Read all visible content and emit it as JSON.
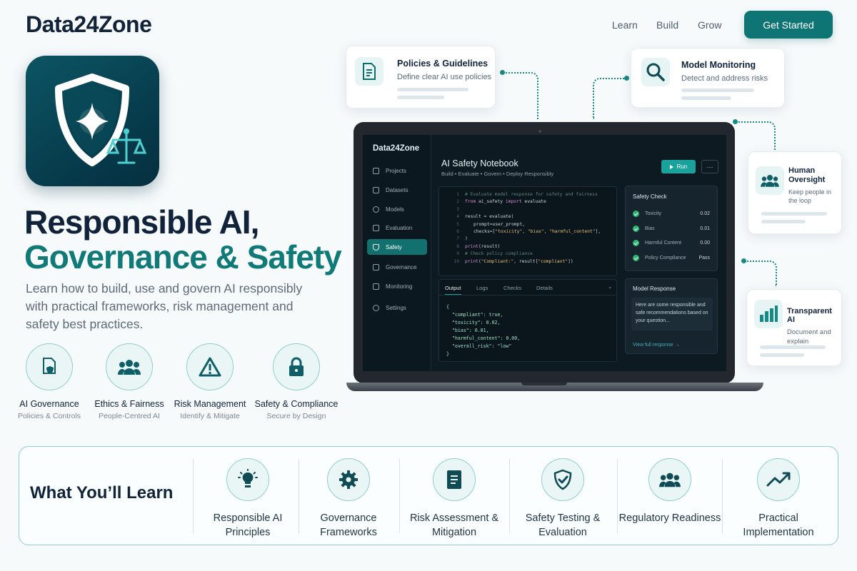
{
  "header": {
    "brand": "Data24Zone",
    "nav": [
      "Learn",
      "Build",
      "Grow"
    ],
    "cta": "Get Started"
  },
  "hero": {
    "title_line1": "Responsible AI,",
    "title_line2": "Governance & Safety",
    "subtitle": "Learn how to build, use and govern AI responsibly with practical frameworks, risk management and safety best practices.",
    "pillars": [
      {
        "title": "AI Governance",
        "sub": "Policies & Controls",
        "icon": "document-shield-icon"
      },
      {
        "title": "Ethics & Fairness",
        "sub": "People-Centred AI",
        "icon": "people-icon"
      },
      {
        "title": "Risk Management",
        "sub": "Identify & Mitigate",
        "icon": "warning-icon"
      },
      {
        "title": "Safety & Compliance",
        "sub": "Secure by Design",
        "icon": "lock-icon"
      }
    ]
  },
  "cards": {
    "policies": {
      "title": "Policies & Guidelines",
      "desc": "Define clear AI use policies"
    },
    "monitoring": {
      "title": "Model Monitoring",
      "desc": "Detect and address risks"
    },
    "oversight": {
      "title": "Human Oversight",
      "desc": "Keep people in the loop"
    },
    "transparent": {
      "title": "Transparent AI",
      "desc": "Document and explain"
    }
  },
  "app": {
    "brand": "Data24Zone",
    "sidebar": [
      "Projects",
      "Datasets",
      "Models",
      "Evaluation",
      "Safety",
      "Governance",
      "Monitoring",
      "Settings"
    ],
    "active_item": "Safety",
    "notebook_title": "AI Safety Notebook",
    "notebook_sub": "Build • Evaluate • Govern • Deploy Responsibly",
    "run_label": "Run",
    "more_label": "···",
    "code": {
      "line_numbers": [
        "1",
        "2",
        "3",
        "4",
        "5",
        "6",
        "7",
        "8",
        "9",
        "10"
      ],
      "line1": "# Evaluate model response for safety and fairness",
      "line2_kw1": "from",
      "line2_mid": " ai_safety ",
      "line2_kw2": "import",
      "line2_end": " evaluate",
      "line4": "result = evaluate(",
      "line5": "prompt=user_prompt,",
      "line6_a": "checks=[",
      "line6_b": "\"toxicity\", \"bias\", \"harmful_content\"",
      "line6_c": "],",
      "line7": ")",
      "line8_kw": "print",
      "line8_end": "(result)",
      "line9": "# Check policy compliance",
      "line10_kw": "print",
      "line10_a": "(",
      "line10_str": "\"Compliant:\"",
      "line10_b": ", result[",
      "line10_str2": "\"compliant\"",
      "line10_c": "])"
    },
    "output_tabs": [
      "Output",
      "Logs",
      "Checks",
      "Details"
    ],
    "collapse_label": "⌄",
    "output_json": "{\n  \"compliant\": true,\n  \"toxicity\": 0.02,\n  \"bias\": 0.01,\n  \"harmful_content\": 0.00,\n  \"overall_risk\": \"low\"\n}",
    "safety_check": {
      "title": "Safety Check",
      "rows": [
        {
          "label": "Toxicity",
          "value": "0.02"
        },
        {
          "label": "Bias",
          "value": "0.01"
        },
        {
          "label": "Harmful Content",
          "value": "0.00"
        },
        {
          "label": "Policy Compliance",
          "value": "Pass"
        }
      ]
    },
    "model_response": {
      "title": "Model Response",
      "text": "Here are some responsible and safe recommendations based on your question...",
      "link": "View full response →"
    }
  },
  "learn": {
    "title": "What You’ll Learn",
    "items": [
      {
        "label": "Responsible AI Principles",
        "icon": "lightbulb-icon"
      },
      {
        "label": "Governance Frameworks",
        "icon": "gear-icon"
      },
      {
        "label": "Risk Assessment & Mitigation",
        "icon": "checklist-icon"
      },
      {
        "label": "Safety Testing & Evaluation",
        "icon": "shield-check-icon"
      },
      {
        "label": "Regulatory Readiness",
        "icon": "people-icon"
      },
      {
        "label": "Practical Implementation",
        "icon": "trend-up-icon"
      }
    ]
  }
}
